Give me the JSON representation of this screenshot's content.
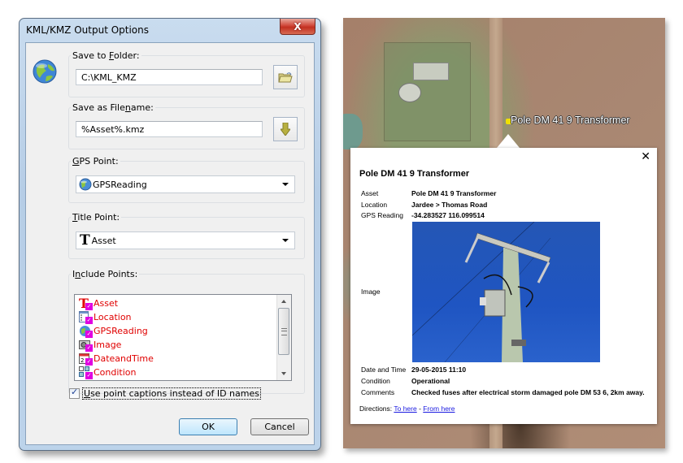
{
  "dialog": {
    "title": "KML/KMZ Output Options",
    "close_label": "X",
    "save_folder": {
      "label_pre": "Save to ",
      "label_u": "F",
      "label_post": "older:",
      "value": "C:\\KML_KMZ",
      "browse_icon": "folder-open-icon"
    },
    "save_filename": {
      "label_pre": "Save as File",
      "label_u": "n",
      "label_post": "ame:",
      "value": "%Asset%.kmz",
      "insert_icon": "down-arrow-icon"
    },
    "gps_point": {
      "label_u": "G",
      "label_post": "PS Point:",
      "selected": "GPSReading",
      "icon": "globe-icon"
    },
    "title_point": {
      "label_u": "T",
      "label_post": "itle Point:",
      "selected": "Asset",
      "icon": "text-icon"
    },
    "include_points": {
      "label_pre": "I",
      "label_u": "n",
      "label_post": "clude Points:",
      "items": [
        {
          "label": "Asset",
          "icon": "text-icon",
          "checked": true
        },
        {
          "label": "Location",
          "icon": "list-icon",
          "checked": true
        },
        {
          "label": "GPSReading",
          "icon": "globe-icon",
          "checked": true
        },
        {
          "label": "Image",
          "icon": "camera-icon",
          "checked": true
        },
        {
          "label": "DateandTime",
          "icon": "calendar-icon",
          "checked": true
        },
        {
          "label": "Condition",
          "icon": "options-icon",
          "checked": true
        }
      ]
    },
    "use_captions": {
      "label_u": "U",
      "label_post": "se point captions instead of ID names",
      "checked": true
    },
    "ok_label": "OK",
    "cancel_label": "Cancel"
  },
  "map": {
    "placemark_label": "Pole DM 41 9 Transformer",
    "popup": {
      "close": "✕",
      "title": "Pole DM 41 9 Transformer",
      "rows": [
        {
          "key": "Asset",
          "value": "Pole DM 41 9 Transformer"
        },
        {
          "key": "Location",
          "value": "Jardee > Thomas Road"
        },
        {
          "key": "GPS Reading",
          "value": "-34.283527 116.099514"
        },
        {
          "key": "Image",
          "value": ""
        },
        {
          "key": "Date and Time",
          "value": "29-05-2015 11:10"
        },
        {
          "key": "Condition",
          "value": "Operational"
        },
        {
          "key": "Comments",
          "value": "Checked fuses after electrical storm damaged pole DM 53 6, 2km away."
        }
      ],
      "directions_label": "Directions: ",
      "to_here": "To here",
      "separator": " - ",
      "from_here": "From here"
    }
  }
}
